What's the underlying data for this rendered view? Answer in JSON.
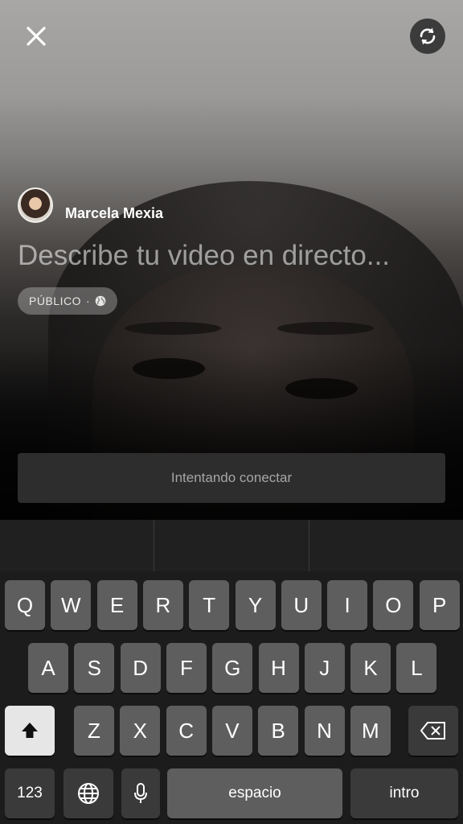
{
  "header": {
    "close_icon": "close-icon",
    "flip_camera_icon": "flip-camera-icon"
  },
  "user": {
    "name": "Marcela Mexia"
  },
  "compose": {
    "placeholder": "Describe tu video en directo..."
  },
  "privacy": {
    "label": "PÚBLICO",
    "separator": "·",
    "icon": "globe-icon"
  },
  "status": {
    "connect_label": "Intentando conectar"
  },
  "keyboard": {
    "row1": [
      "Q",
      "W",
      "E",
      "R",
      "T",
      "Y",
      "U",
      "I",
      "O",
      "P"
    ],
    "row2": [
      "A",
      "S",
      "D",
      "F",
      "G",
      "H",
      "J",
      "K",
      "L"
    ],
    "row3": [
      "Z",
      "X",
      "C",
      "V",
      "B",
      "N",
      "M"
    ],
    "numbers_label": "123",
    "space_label": "espacio",
    "return_label": "intro",
    "shift_icon": "shift-icon",
    "delete_icon": "delete-icon",
    "globe_icon": "globe-icon",
    "mic_icon": "microphone-icon"
  }
}
